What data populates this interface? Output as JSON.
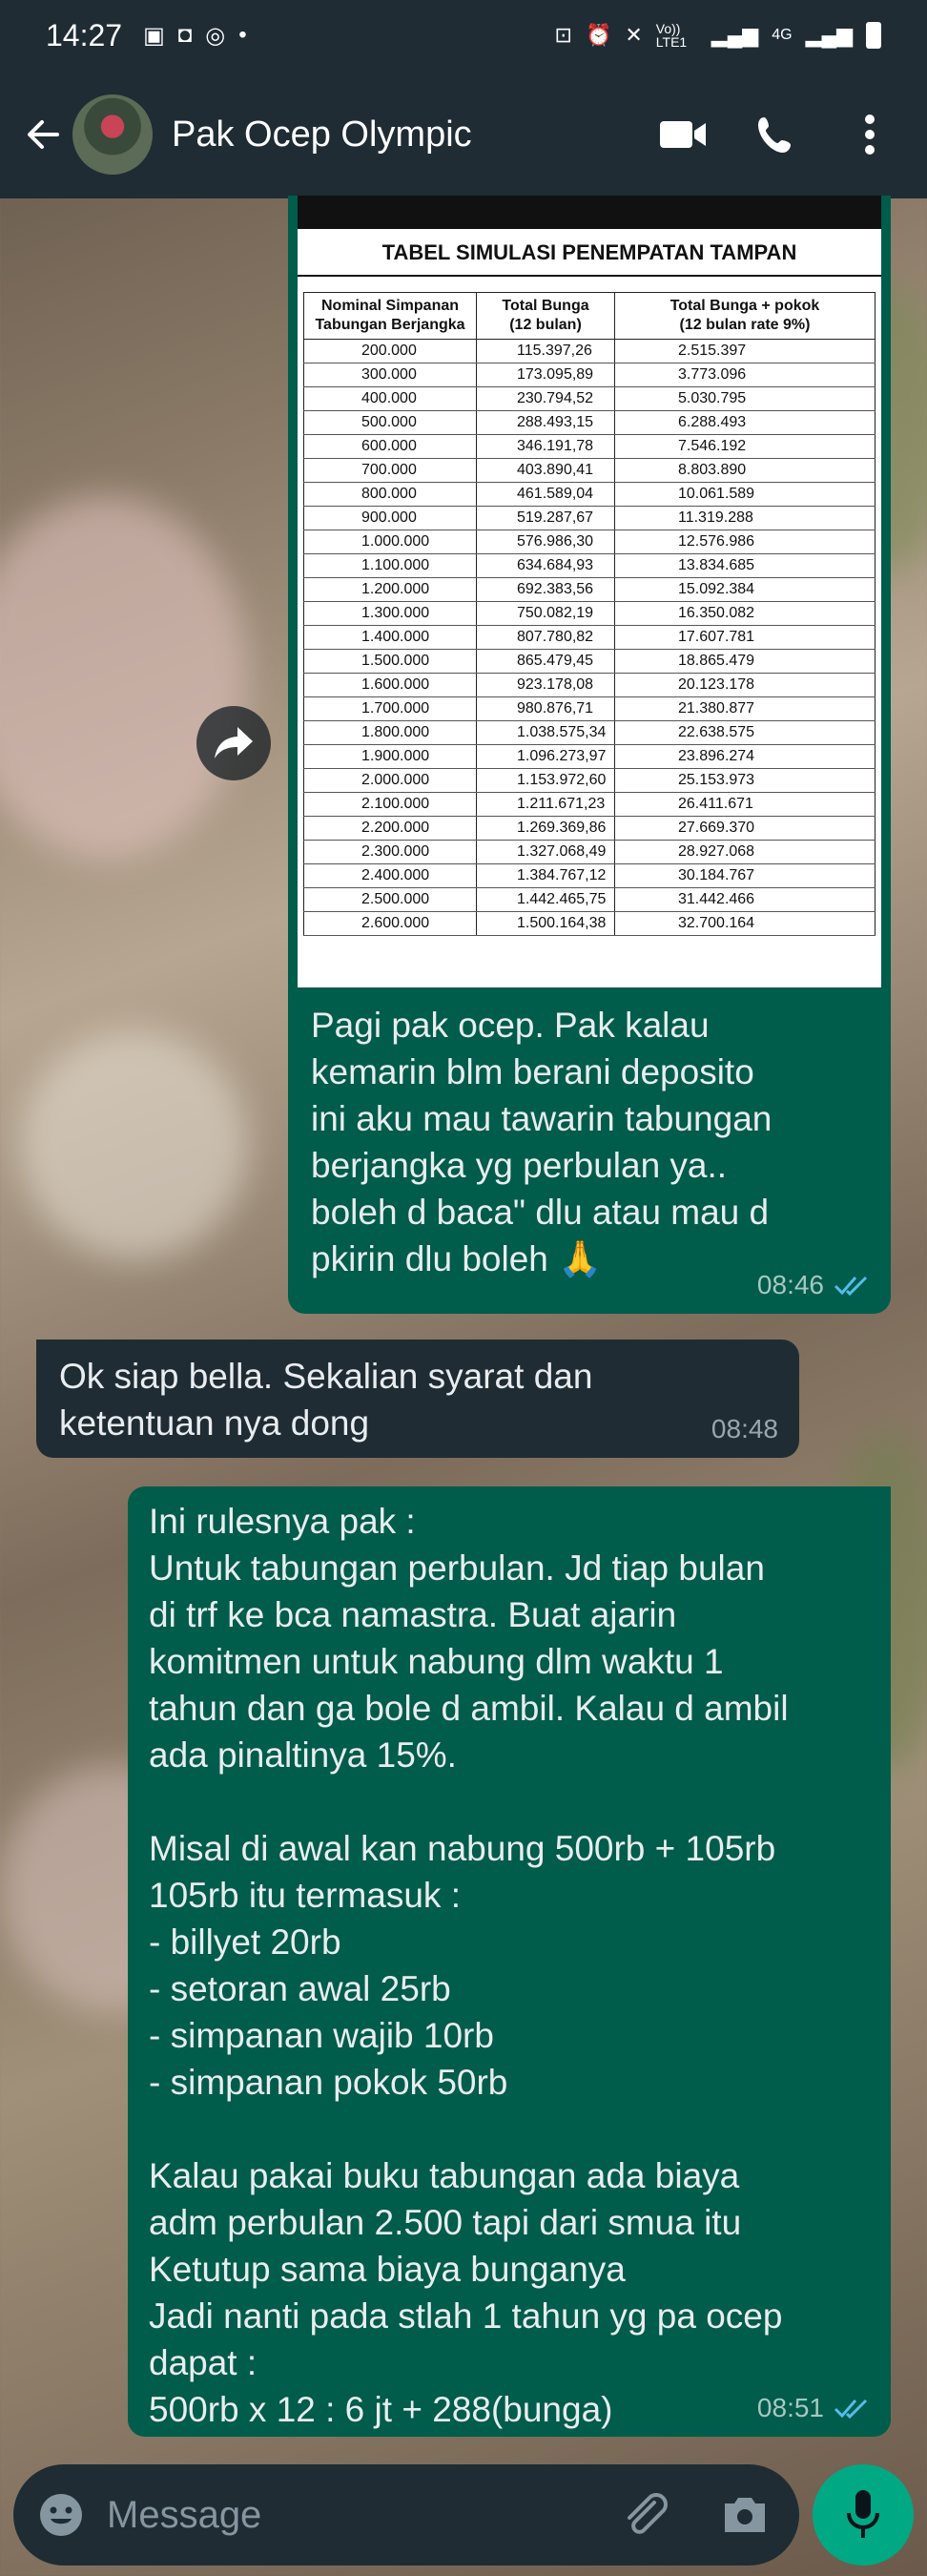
{
  "status_bar": {
    "time": "14:27",
    "network": "4G",
    "volte": "Vo)) LTE1"
  },
  "header": {
    "contact_name": "Pak Ocep Olympic",
    "icons": [
      "back-arrow-icon",
      "video-call-icon",
      "voice-call-icon",
      "more-vert-icon"
    ]
  },
  "table_image": {
    "title": "TABEL SIMULASI PENEMPATAN TAMPAN",
    "headers": [
      "Nominal Simpanan\nTabungan Berjangka",
      "Total Bunga\n(12 bulan)",
      "Total Bunga + pokok\n(12 bulan rate 9%)"
    ],
    "rows": [
      [
        "200.000",
        "115.397,26",
        "2.515.397"
      ],
      [
        "300.000",
        "173.095,89",
        "3.773.096"
      ],
      [
        "400.000",
        "230.794,52",
        "5.030.795"
      ],
      [
        "500.000",
        "288.493,15",
        "6.288.493"
      ],
      [
        "600.000",
        "346.191,78",
        "7.546.192"
      ],
      [
        "700.000",
        "403.890,41",
        "8.803.890"
      ],
      [
        "800.000",
        "461.589,04",
        "10.061.589"
      ],
      [
        "900.000",
        "519.287,67",
        "11.319.288"
      ],
      [
        "1.000.000",
        "576.986,30",
        "12.576.986"
      ],
      [
        "1.100.000",
        "634.684,93",
        "13.834.685"
      ],
      [
        "1.200.000",
        "692.383,56",
        "15.092.384"
      ],
      [
        "1.300.000",
        "750.082,19",
        "16.350.082"
      ],
      [
        "1.400.000",
        "807.780,82",
        "17.607.781"
      ],
      [
        "1.500.000",
        "865.479,45",
        "18.865.479"
      ],
      [
        "1.600.000",
        "923.178,08",
        "20.123.178"
      ],
      [
        "1.700.000",
        "980.876,71",
        "21.380.877"
      ],
      [
        "1.800.000",
        "1.038.575,34",
        "22.638.575"
      ],
      [
        "1.900.000",
        "1.096.273,97",
        "23.896.274"
      ],
      [
        "2.000.000",
        "1.153.972,60",
        "25.153.973"
      ],
      [
        "2.100.000",
        "1.211.671,23",
        "26.411.671"
      ],
      [
        "2.200.000",
        "1.269.369,86",
        "27.669.370"
      ],
      [
        "2.300.000",
        "1.327.068,49",
        "28.927.068"
      ],
      [
        "2.400.000",
        "1.384.767,12",
        "30.184.767"
      ],
      [
        "2.500.000",
        "1.442.465,75",
        "31.442.466"
      ],
      [
        "2.600.000",
        "1.500.164,38",
        "32.700.164"
      ]
    ]
  },
  "messages": [
    {
      "text": "Pagi pak ocep. Pak kalau\nkemarin blm berani deposito\nini aku mau tawarin tabungan\nberjangka yg perbulan ya..\nboleh d baca\" dlu atau mau d\npkirin dlu boleh 🙏",
      "time": "08:46"
    },
    {
      "text": "Ok siap bella. Sekalian syarat dan\nketentuan nya dong",
      "time": "08:48"
    },
    {
      "text": "Ini rulesnya pak :\nUntuk tabungan perbulan. Jd tiap bulan\ndi trf ke bca namastra. Buat ajarin\nkomitmen untuk nabung dlm waktu 1\ntahun dan ga bole d ambil. Kalau d ambil\nada pinaltinya 15%.\n\nMisal di awal kan nabung 500rb + 105rb\n105rb itu termasuk :\n- billyet 20rb\n- setoran awal 25rb\n- simpanan wajib 10rb\n- simpanan pokok 50rb\n\nKalau pakai buku tabungan ada biaya\nadm perbulan 2.500 tapi dari smua itu\nKetutup sama biaya bunganya\nJadi nanti pada stlah 1 tahun yg pa ocep\ndapat :\n500rb x 12 : 6 jt + 288(bunga)",
      "time": "08:51"
    }
  ],
  "composer": {
    "placeholder": "Message"
  },
  "colors": {
    "header_bg": "#1f2c34",
    "outgoing_bubble": "#005c4b",
    "incoming_bubble": "#1f2c34",
    "mic_button": "#00a884",
    "read_ticks": "#53bdeb"
  }
}
